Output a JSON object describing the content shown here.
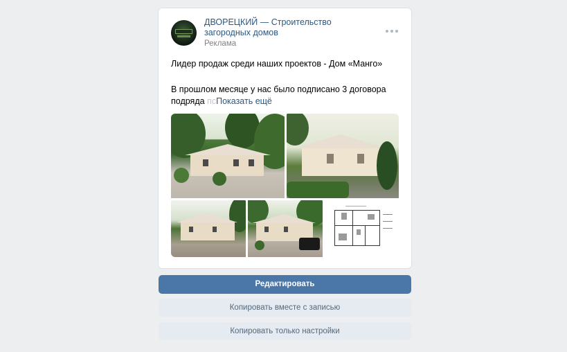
{
  "post": {
    "author": "ДВОРЕЦКИЙ — Строительство загородных домов",
    "label": "Реклама",
    "text_line1": "Лидер продаж среди наших проектов - Дом «Манго»",
    "text_line2_main": "В прошлом месяце у нас было подписано 3 договора подряда ",
    "text_line2_fade": "пс",
    "show_more": "Показать ещё"
  },
  "actions": {
    "edit": "Редактировать",
    "copy_with_post": "Копировать вместе с записью",
    "copy_settings_only": "Копировать только настройки"
  },
  "icons": {
    "more": "more-dots-icon"
  },
  "colors": {
    "link": "#2a5885",
    "primary_button": "#4a76a8",
    "secondary_button": "#e5ebf1",
    "background": "#edeef0"
  }
}
